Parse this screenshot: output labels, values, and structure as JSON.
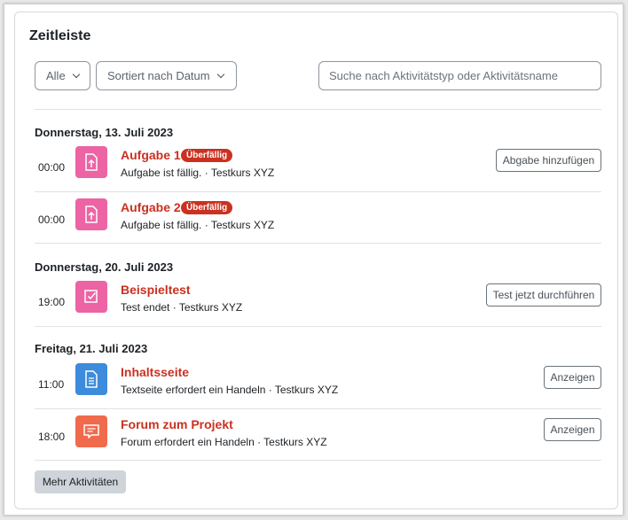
{
  "block": {
    "title": "Zeitleiste",
    "filter_label": "Alle",
    "sort_label": "Sortiert nach Datum",
    "search_placeholder": "Suche nach Aktivitätstyp oder Aktivitätsname",
    "more_label": "Mehr Aktivitäten"
  },
  "groups": [
    {
      "date": "Donnerstag, 13. Juli 2023",
      "items": [
        {
          "time": "00:00",
          "icon": "assignment-upload-icon",
          "name": "Aufgabe 1",
          "badge": "Überfällig",
          "sub": "Aufgabe ist fällig. · Testkurs XYZ",
          "action": "Abgabe hinzufügen"
        },
        {
          "time": "00:00",
          "icon": "assignment-upload-icon",
          "name": "Aufgabe 2",
          "badge": "Überfällig",
          "sub": "Aufgabe ist fällig. · Testkurs XYZ",
          "action": ""
        }
      ]
    },
    {
      "date": "Donnerstag, 20. Juli 2023",
      "items": [
        {
          "time": "19:00",
          "icon": "quiz-checkbox-icon",
          "name": "Beispieltest",
          "badge": "",
          "sub": "Test endet · Testkurs XYZ",
          "action": "Test jetzt durchführen"
        }
      ]
    },
    {
      "date": "Freitag, 21. Juli 2023",
      "items": [
        {
          "time": "11:00",
          "icon": "page-document-icon",
          "name": "Inhaltsseite",
          "badge": "",
          "sub": "Textseite erfordert ein Handeln · Testkurs XYZ",
          "action": "Anzeigen"
        },
        {
          "time": "18:00",
          "icon": "forum-chat-icon",
          "name": "Forum zum Projekt",
          "badge": "",
          "sub": "Forum erfordert ein Handeln · Testkurs XYZ",
          "action": "Anzeigen"
        }
      ]
    }
  ],
  "colors": {
    "activity_name": "#ca3120",
    "badge": "#ca3120",
    "assignment_icon_bg": "#ec64a4",
    "page_icon_bg": "#3d8bdc",
    "forum_icon_bg": "#f06a4c"
  }
}
